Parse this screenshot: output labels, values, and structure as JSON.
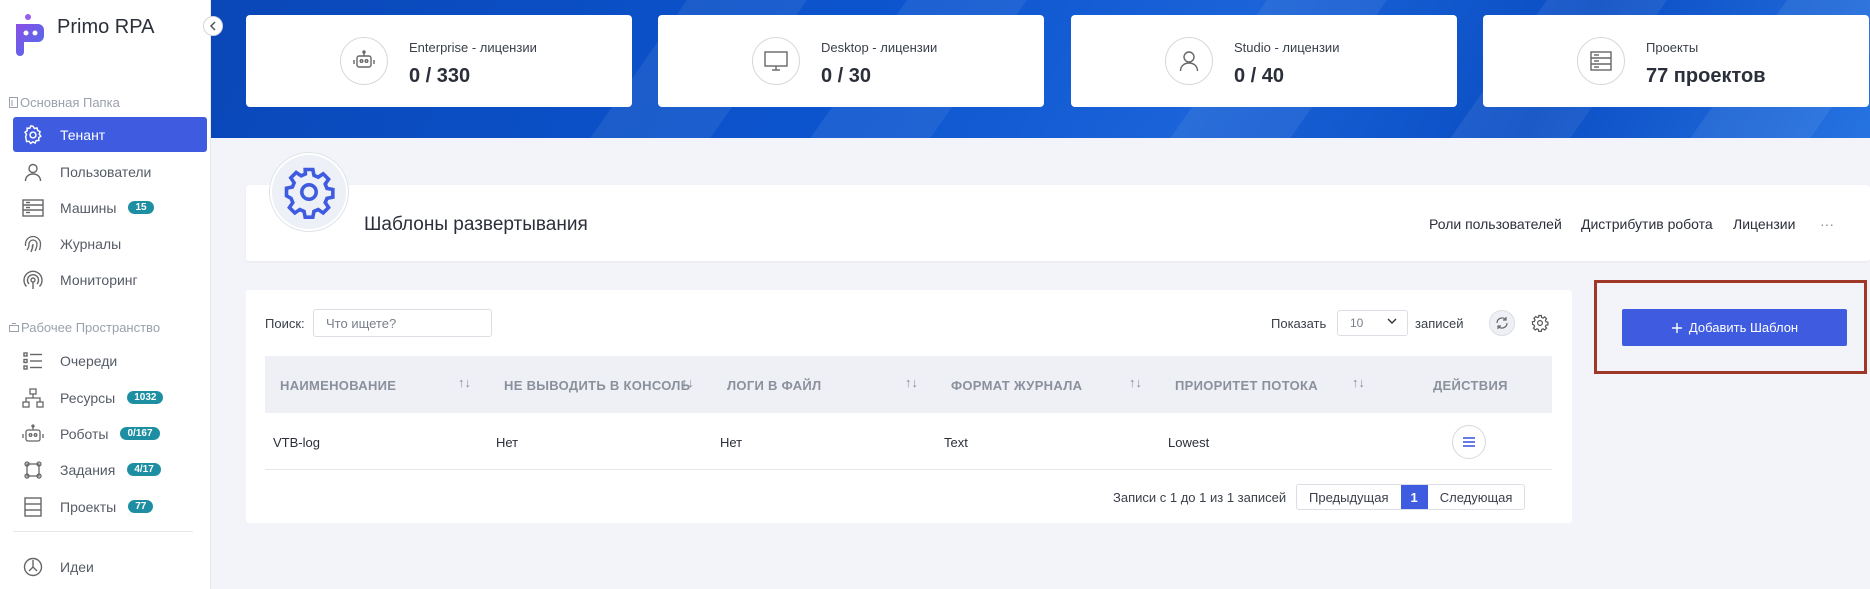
{
  "app": {
    "title": "Primo RPA"
  },
  "sidebar": {
    "section1": "Основная Папка",
    "section2": "Рабочее Пространство",
    "items": [
      {
        "label": "Тенант"
      },
      {
        "label": "Пользователи"
      },
      {
        "label": "Машины",
        "badge": "15"
      },
      {
        "label": "Журналы"
      },
      {
        "label": "Мониторинг"
      },
      {
        "label": "Очереди"
      },
      {
        "label": "Ресурсы",
        "badge": "1032"
      },
      {
        "label": "Роботы",
        "badge": "0/167"
      },
      {
        "label": "Задания",
        "badge": "4/17"
      },
      {
        "label": "Проекты",
        "badge": "77"
      },
      {
        "label": "Идеи"
      }
    ]
  },
  "stats": [
    {
      "label": "Enterprise - лицензии",
      "value": "0 / 330",
      "icon": "robot-icon"
    },
    {
      "label": "Desktop - лицензии",
      "value": "0 / 30",
      "icon": "monitor-icon"
    },
    {
      "label": "Studio - лицензии",
      "value": "0 / 40",
      "icon": "user-icon"
    },
    {
      "label": "Проекты",
      "value": "77 проектов",
      "icon": "projects-icon"
    }
  ],
  "header": {
    "title": "Шаблоны развертывания",
    "links": [
      "Роли пользователей",
      "Дистрибутив робота",
      "Лицензии",
      "···"
    ]
  },
  "toolbar": {
    "search_label": "Поиск:",
    "search_placeholder": "Что ищете?",
    "show_label": "Показать",
    "page_size": "10",
    "records_label": "записей"
  },
  "table": {
    "columns": [
      "НАИМЕНОВАНИЕ",
      "НЕ ВЫВОДИТЬ В КОНСОЛЬ",
      "ЛОГИ В ФАЙЛ",
      "ФОРМАТ ЖУРНАЛА",
      "ПРИОРИТЕТ ПОТОКА",
      "ДЕЙСТВИЯ"
    ],
    "rows": [
      [
        "VTB-log",
        "Нет",
        "Нет",
        "Text",
        "Lowest"
      ]
    ]
  },
  "pager": {
    "info": "Записи с 1 до 1 из 1 записей",
    "prev": "Предыдущая",
    "current": "1",
    "next": "Следующая"
  },
  "add_button": {
    "label": "Добавить Шаблон"
  },
  "colors": {
    "accent": "#3f5ce0",
    "banner": "#0c55cf",
    "badge": "#1e8fa3",
    "highlight": "#a0382a"
  }
}
